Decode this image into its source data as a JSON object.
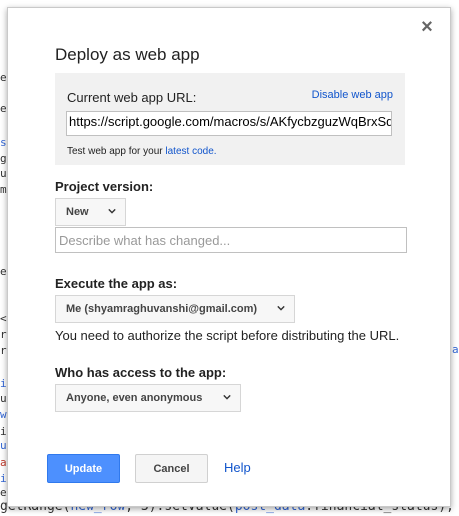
{
  "background_code": {
    "bottom_line": {
      "prefix": "getRange(",
      "arg1": "new_row",
      "mid": ", 3).setValue(",
      "arg2": "post_data",
      "suffix": ".financial_status);"
    },
    "left_glyphs": [
      "e",
      "e",
      "s",
      "g",
      "u",
      "m",
      "e",
      "<",
      "r",
      "r",
      "i",
      "u",
      "w",
      "i",
      "u",
      "a",
      "i",
      "e"
    ],
    "right_glyph": "a"
  },
  "dialog": {
    "title": "Deploy as web app",
    "close_glyph": "×",
    "url_section": {
      "label": "Current web app URL:",
      "disable_link": "Disable web app",
      "url_value": "https://script.google.com/macros/s/AKfycbzguzWqBrxSqj",
      "test_prefix": "Test web app for your ",
      "test_link": "latest code."
    },
    "project_version": {
      "label": "Project version:",
      "selected": "New",
      "description_placeholder": "Describe what has changed..."
    },
    "execute_as": {
      "label": "Execute the app as:",
      "selected": "Me (shyamraghuvanshi@gmail.com)",
      "note": "You need to authorize the script before distributing the URL."
    },
    "access": {
      "label": "Who has access to the app:",
      "selected": "Anyone, even anonymous"
    },
    "buttons": {
      "update": "Update",
      "cancel": "Cancel",
      "help": "Help"
    }
  },
  "colors": {
    "primary_button": "#4d90fe",
    "link": "#1155cc"
  }
}
